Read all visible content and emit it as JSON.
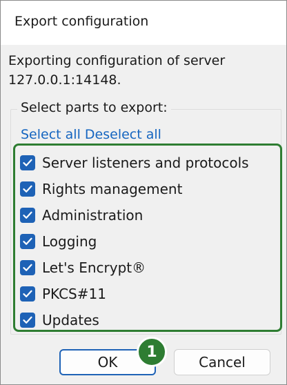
{
  "dialog": {
    "title": "Export configuration",
    "intro_line1": "Exporting configuration of server",
    "intro_line2": "127.0.0.1:14148."
  },
  "group": {
    "legend": "Select parts to export:",
    "select_all_label": "Select all",
    "deselect_all_label": "Deselect all"
  },
  "options": [
    {
      "label": "Server listeners and protocols",
      "checked": true
    },
    {
      "label": "Rights management",
      "checked": true
    },
    {
      "label": "Administration",
      "checked": true
    },
    {
      "label": "Logging",
      "checked": true
    },
    {
      "label": "Let's Encrypt®",
      "checked": true
    },
    {
      "label": "PKCS#11",
      "checked": true
    },
    {
      "label": "Updates",
      "checked": true
    }
  ],
  "buttons": {
    "ok_label": "OK",
    "cancel_label": "Cancel"
  },
  "annotation": {
    "step_number": "1",
    "color": "#2e7d32"
  },
  "colors": {
    "checkbox": "#1e62b6",
    "link": "#1565c0",
    "highlight_border": "#2e7d32"
  }
}
